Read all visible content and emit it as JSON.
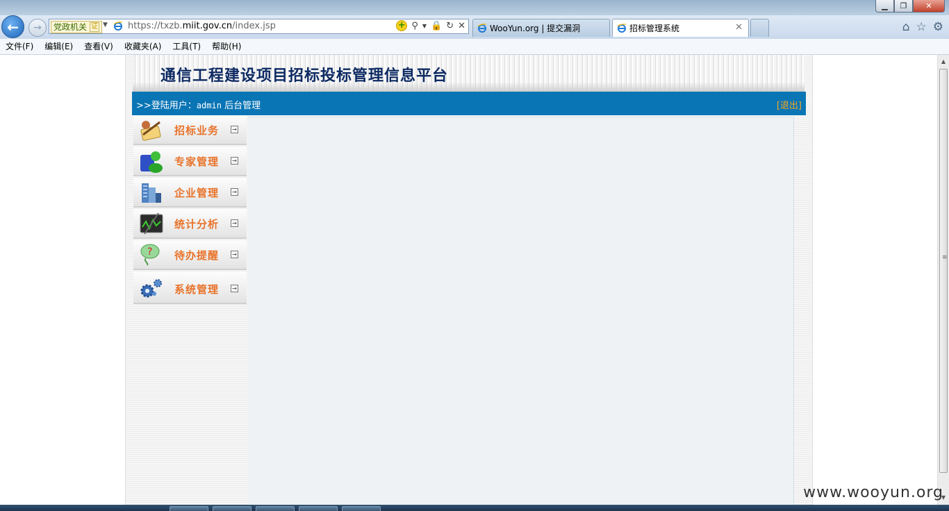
{
  "browser": {
    "address_badge": "党政机关",
    "address_cert": "证",
    "url_host": "https://txzb.",
    "url_domain": "miit.gov.cn",
    "url_path": "/index.jsp",
    "tabs": [
      {
        "label": "WooYun.org | 提交漏洞"
      },
      {
        "label": "招标管理系统"
      }
    ],
    "menu": [
      "文件(F)",
      "编辑(E)",
      "查看(V)",
      "收藏夹(A)",
      "工具(T)",
      "帮助(H)"
    ]
  },
  "page": {
    "title": "通信工程建设项目招标投标管理信息平台",
    "user_prefix": ">>登陆用户：",
    "user_name": "admin",
    "user_role": "后台管理",
    "logout": "[退出]",
    "nav": [
      {
        "label": "招标业务",
        "icon": "bidding-icon"
      },
      {
        "label": "专家管理",
        "icon": "experts-icon"
      },
      {
        "label": "企业管理",
        "icon": "enterprise-icon"
      },
      {
        "label": "统计分析",
        "icon": "statistics-icon"
      },
      {
        "label": "待办提醒",
        "icon": "reminder-icon"
      },
      {
        "label": "系统管理",
        "icon": "system-gear-icon"
      }
    ]
  },
  "watermark": "www.wooyun.org"
}
